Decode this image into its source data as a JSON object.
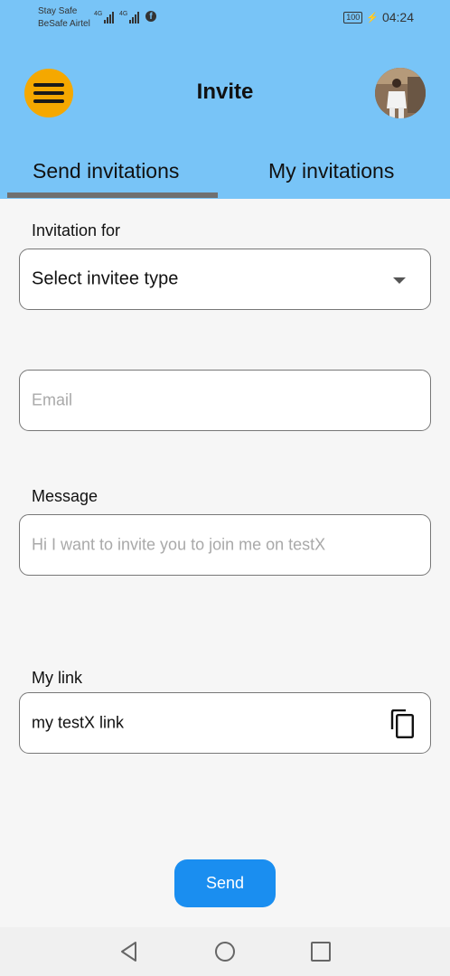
{
  "status_bar": {
    "carrier_line1": "Stay Safe",
    "carrier_line2": "BeSafe Airtel",
    "network1": "4G",
    "network2": "4G",
    "battery": "100",
    "time": "04:24",
    "icons": [
      "signal-icon",
      "signal-icon",
      "facebook-icon",
      "battery-icon",
      "charging-icon"
    ]
  },
  "header": {
    "title": "Invite",
    "menu_icon": "hamburger-menu-icon",
    "avatar_icon": "user-avatar",
    "background_color": "#78c4f7",
    "menu_color": "#f5a800"
  },
  "tabs": [
    {
      "label": "Send invitations",
      "active": true
    },
    {
      "label": "My invitations",
      "active": false
    }
  ],
  "form": {
    "invitation_for": {
      "label": "Invitation for",
      "selected": "Select invitee type",
      "icon": "dropdown-arrow-icon"
    },
    "email": {
      "placeholder": "Email",
      "value": ""
    },
    "message": {
      "label": "Message",
      "placeholder": "Hi I want to invite you to join me on testX",
      "value": ""
    },
    "link": {
      "label": "My link",
      "value": "my testX link",
      "icon": "copy-icon"
    }
  },
  "send_button": {
    "label": "Send",
    "color": "#1a8ef0"
  },
  "nav_bar": {
    "icons": [
      "back-triangle-icon",
      "home-circle-icon",
      "recents-square-icon"
    ]
  }
}
